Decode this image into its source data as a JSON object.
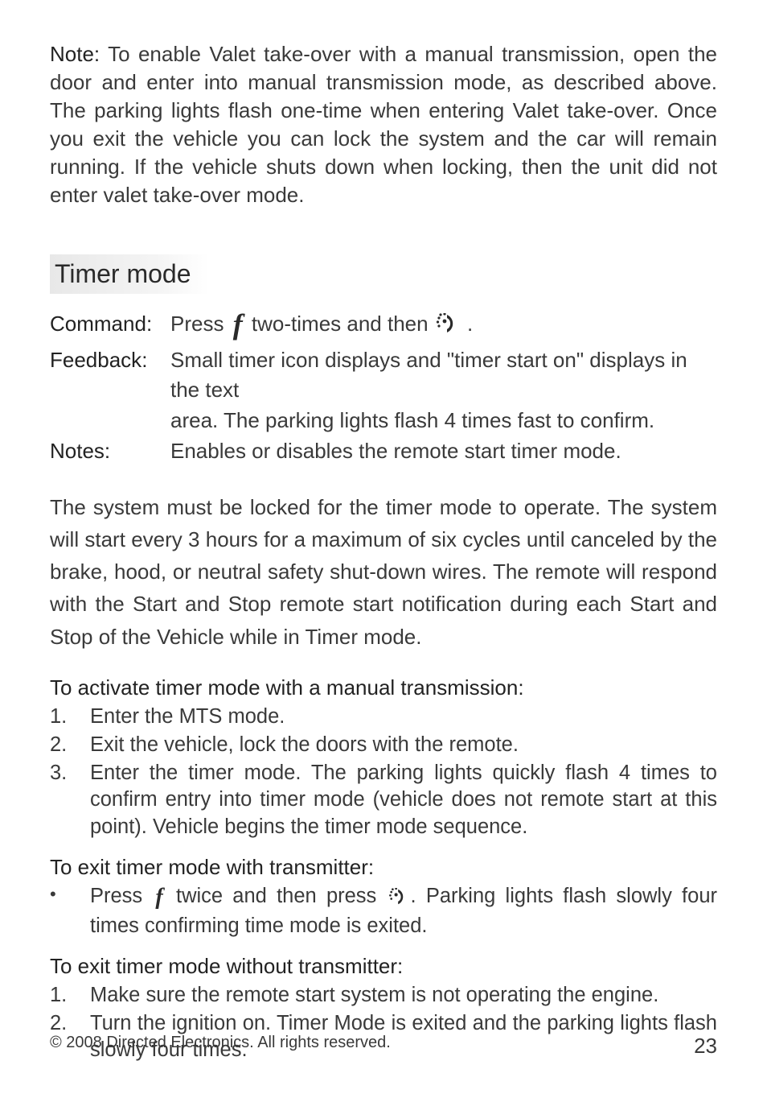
{
  "note": {
    "lead": "Note:",
    "body": " To enable Valet take-over with a manual transmission, open the door  and enter into manual transmission mode, as described above. The parking lights flash one-time when entering Valet take-over. Once you exit the vehicle you can lock the system and the car will remain running. If the vehicle shuts down when locking, then the unit did not enter valet take-over mode."
  },
  "section_title": "Timer mode",
  "cmd": {
    "command_label": "Command",
    "command_pre": "Press ",
    "command_mid": " two-times and then ",
    "command_post": " .",
    "feedback_label": "Feedback",
    "feedback_line1": "Small timer icon displays and \"timer start on\" displays in the text",
    "feedback_line2": "area. The parking lights flash 4 times fast to confirm.",
    "notes_label": "Notes",
    "notes_value": "Enables or disables the remote start timer mode."
  },
  "body_para": "The system must be locked for the timer mode to operate. The system will start every 3 hours for a maximum of six cycles until canceled by the brake, hood, or neutral safety shut-down wires. The remote will respond with the Start and Stop remote start notification during each Start and Stop of the Vehicle while in Timer mode.",
  "activate": {
    "heading": "To activate timer mode with a manual transmission:",
    "items": [
      "Enter the MTS mode.",
      "Exit the vehicle, lock the doors with the remote.",
      "Enter the timer mode. The parking lights quickly flash 4 times to confirm entry into timer mode (vehicle does not remote start at this point). Vehicle begins the timer mode sequence."
    ]
  },
  "exit_with": {
    "heading": "To exit timer mode with transmitter:",
    "bullet_pre": "Press ",
    "bullet_mid": " twice and then press ",
    "bullet_post": ". Parking lights flash slowly four times confirming time mode is exited."
  },
  "exit_without": {
    "heading": "To exit timer mode without transmitter:",
    "items": [
      "Make sure the remote start system is not operating the engine.",
      "Turn the ignition on. Timer Mode is exited and the parking lights  flash slowly four times."
    ]
  },
  "footer": {
    "copyright": "© 2008 Directed Electronics. All rights reserved.",
    "page": "23"
  },
  "colon": ":"
}
